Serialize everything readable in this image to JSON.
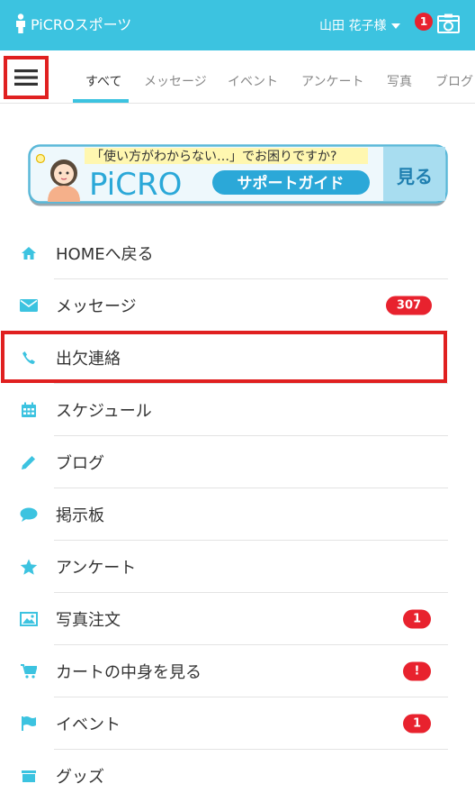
{
  "header": {
    "app_title": "PiCROスポーツ",
    "user_name": "山田 花子様",
    "notification_count": "1",
    "brand_color": "#3cc3e0",
    "alert_color": "#e8222e"
  },
  "tabs": [
    {
      "label": "すべて",
      "active": true
    },
    {
      "label": "メッセージ"
    },
    {
      "label": "イベント"
    },
    {
      "label": "アンケート"
    },
    {
      "label": "写真"
    },
    {
      "label": "ブログ"
    }
  ],
  "banner": {
    "question": "「使い方がわからない…」でお困りですか?",
    "logo": "PiCRO",
    "guide": "サポートガイド",
    "button": "見る"
  },
  "menu": [
    {
      "label": "HOMEへ戻る",
      "icon": "home-icon"
    },
    {
      "label": "メッセージ",
      "icon": "envelope-icon",
      "badge": "307"
    },
    {
      "label": "出欠連絡",
      "icon": "phone-icon",
      "highlighted": true
    },
    {
      "label": "スケジュール",
      "icon": "calendar-icon"
    },
    {
      "label": "ブログ",
      "icon": "pencil-icon"
    },
    {
      "label": "掲示板",
      "icon": "speech-bubble-icon"
    },
    {
      "label": "アンケート",
      "icon": "star-icon"
    },
    {
      "label": "写真注文",
      "icon": "picture-icon",
      "badge": "1"
    },
    {
      "label": "カートの中身を見る",
      "icon": "cart-icon",
      "badge": "!"
    },
    {
      "label": "イベント",
      "icon": "flag-icon",
      "badge": "1"
    },
    {
      "label": "グッズ",
      "icon": "goods-icon"
    }
  ]
}
